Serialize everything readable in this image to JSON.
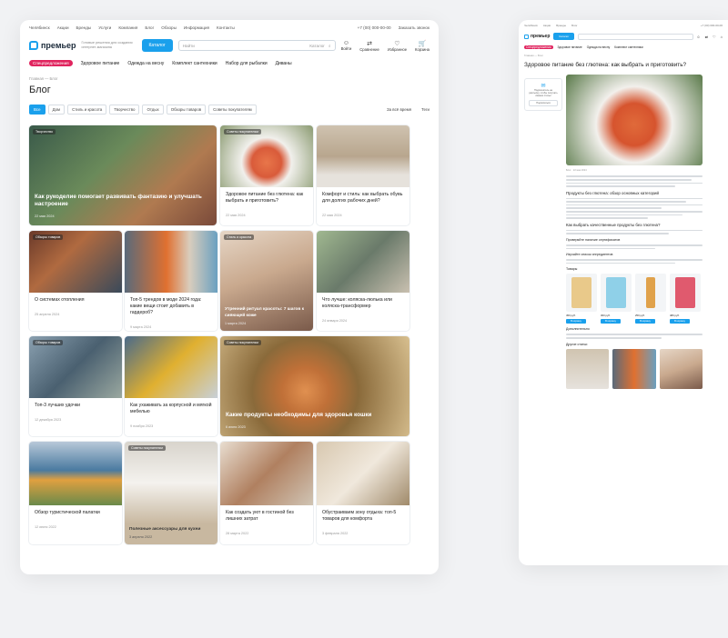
{
  "left": {
    "topbar": {
      "city": "Челябинск",
      "links": [
        "Акции",
        "Бренды",
        "Услуги",
        "Компания",
        "Блог",
        "Обзоры",
        "Информация",
        "Контакты"
      ],
      "phone": "+7 (00) 000-00-00",
      "callback": "Заказать звонок"
    },
    "header": {
      "logo": "премьер",
      "tagline": "Готовые решения для создания интернет-магазина",
      "catalog": "Каталог",
      "search_placeholder": "Найти",
      "search_scope": "Каталог",
      "icons": [
        {
          "label": "Войти",
          "glyph": "☺"
        },
        {
          "label": "Сравнение",
          "glyph": "⇄"
        },
        {
          "label": "Избранное",
          "glyph": "♡"
        },
        {
          "label": "Корзина",
          "glyph": "🛒"
        }
      ]
    },
    "promos": {
      "badge": "Спецпредложения",
      "items": [
        "Здоровое питание",
        "Одежда на весну",
        "Комплект сантехники",
        "Набор для рыбалки",
        "Диваны"
      ]
    },
    "breadcrumbs": "Главная  —  Блог",
    "title": "Блог",
    "filters": [
      "Все",
      "Дом",
      "Стиль и красота",
      "Творчество",
      "Отдых",
      "Обзоры товаров",
      "Советы покупателям"
    ],
    "sort": "За всё время",
    "tags": "Теги",
    "posts": [
      {
        "tag": "Творчество",
        "title": "Как рукоделие помогает развивать фантазию и улучшать настроение",
        "date": "22 мая 2024"
      },
      {
        "tag": "Советы покупателям",
        "title": "Здоровое питание без глютена: как выбрать и приготовить?",
        "date": "22 мая 2024"
      },
      {
        "tag": "",
        "title": "Комфорт и стиль: как выбрать обувь для долгих рабочих дней?",
        "date": "22 мая 2024"
      },
      {
        "tag": "Обзоры товаров",
        "title": "О системах отопления",
        "date": "25 апреля 2024"
      },
      {
        "tag": "",
        "title": "Топ-5 трендов в моде 2024 года: какие вещи стоит добавить в гардероб?",
        "date": "9 марта 2024"
      },
      {
        "tag": "Стиль и красота",
        "title": "Утренний ритуал красоты: 7 шагов к сияющей коже",
        "date": "1 марта 2024"
      },
      {
        "tag": "",
        "title": "Что лучше: коляска-люлька или коляска-трансформер",
        "date": "24 января 2024"
      },
      {
        "tag": "Обзоры товаров",
        "title": "Топ-3 лучших удочки",
        "date": "12 декабря 2023"
      },
      {
        "tag": "",
        "title": "Как ухаживать за корпусной и мягкой мебелью",
        "date": "9 ноября 2023"
      },
      {
        "tag": "Советы покупателям",
        "title": "Какие продукты необходимы для здоровья кошки",
        "date": "6 июня 2023"
      },
      {
        "tag": "",
        "title": "Обзор туристической палатки",
        "date": "12 июня 2022"
      },
      {
        "tag": "Советы покупателям",
        "title": "Полезные аксессуары для кухни",
        "date": "3 апреля 2022"
      },
      {
        "tag": "",
        "title": "Как создать уют в гостиной без лишних затрат",
        "date": "28 марта 2022"
      },
      {
        "tag": "",
        "title": "Обустраиваем зону отдыха: топ-5 товаров для комфорта",
        "date": "3 февраля 2022"
      }
    ]
  },
  "right": {
    "title": "Здоровое питание без глютена: как выбрать и приготовить?",
    "side_note": "Подпишитесь на рассылку, чтобы получать свежие статьи",
    "side_btn": "Подписаться",
    "meta": "Блог  ·  22 мая 2024",
    "section1": "Продукты без глютена: обзор основных категорий",
    "section2": "Как выбрать качественные продукты без глютена?",
    "sub1": "Проверяйте наличие сертификатов",
    "sub2": "Изучайте список ингредиентов",
    "products_heading": "Товары",
    "products": [
      {
        "price": "450 руб.",
        "btn": "В корзину",
        "color": "#e9c98a"
      },
      {
        "price": "300 руб.",
        "btn": "В корзину",
        "color": "#8fd0e8"
      },
      {
        "price": "250 руб.",
        "btn": "В корзину",
        "color": "#e0a24b"
      },
      {
        "price": "480 руб.",
        "btn": "В корзину",
        "color": "#e05a6e"
      }
    ],
    "more_heading": "Дополнительно",
    "others_heading": "Другие статьи"
  }
}
